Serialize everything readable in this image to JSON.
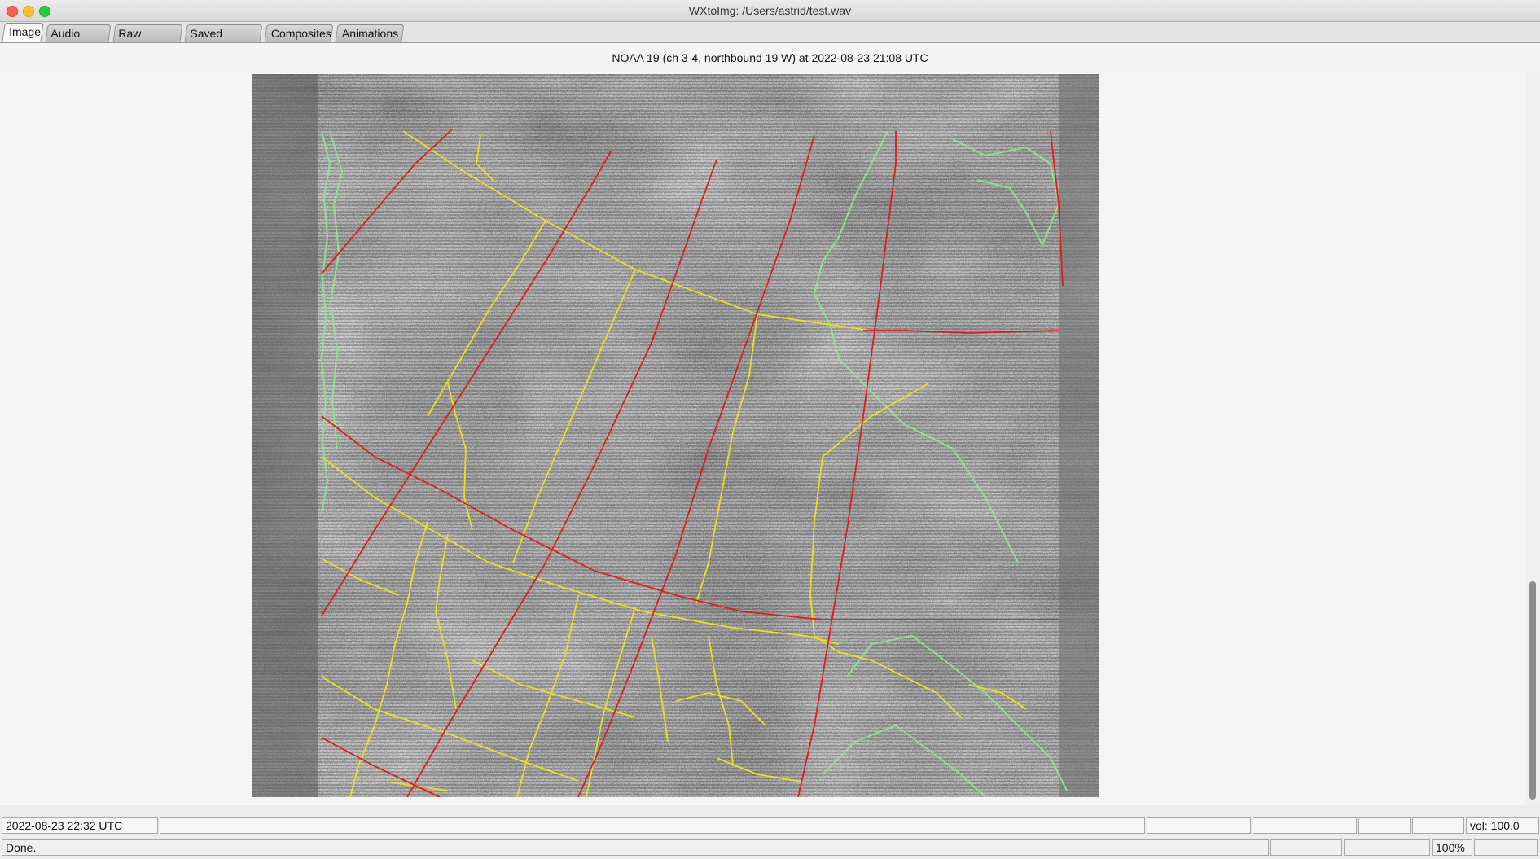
{
  "window": {
    "title": "WXtoImg: /Users/astrid/test.wav"
  },
  "tabs": [
    {
      "label": "Image",
      "active": true
    },
    {
      "label": "Audio Files",
      "active": false
    },
    {
      "label": "Raw Images",
      "active": false
    },
    {
      "label": "Saved Images",
      "active": false
    },
    {
      "label": "Composites",
      "active": false
    },
    {
      "label": "Animations",
      "active": false
    }
  ],
  "image_header": "NOAA 19 (ch 3-4, northbound 19 W) at 2022-08-23  21:08 UTC",
  "status": {
    "time": "2022-08-23  22:32 UTC",
    "volume": "vol: 100.0",
    "message": "Done.",
    "zoom": "100%"
  },
  "colors": {
    "grid_lines": "#e01c1c",
    "borders": "#e8e020",
    "coastlines": "#7fe07f"
  }
}
